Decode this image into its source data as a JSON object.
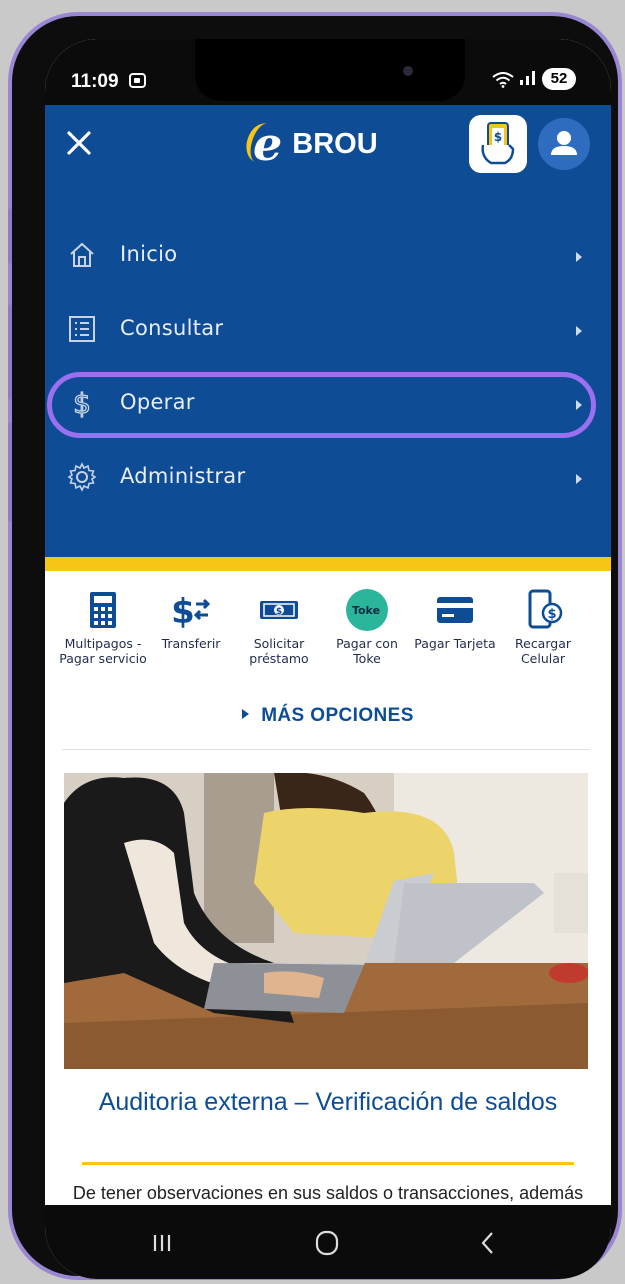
{
  "status_bar": {
    "time": "11:09",
    "battery": "52",
    "icons": [
      "screenshot-notification-icon",
      "wifi-icon",
      "signal-icon",
      "battery-icon"
    ]
  },
  "header": {
    "logo_text": "BROU",
    "brand_colors": {
      "blue": "#0e4c95",
      "yellow": "#f6c515",
      "highlight": "#9a6ff0"
    }
  },
  "menu": {
    "items": [
      {
        "label": "Inicio",
        "icon": "home-icon"
      },
      {
        "label": "Consultar",
        "icon": "list-icon"
      },
      {
        "label": "Operar",
        "icon": "dollar-icon",
        "highlighted": true
      },
      {
        "label": "Administrar",
        "icon": "gear-icon"
      }
    ]
  },
  "shortcuts": [
    {
      "label": "Multipagos - Pagar servicio",
      "icon": "calculator-icon"
    },
    {
      "label": "Transferir",
      "icon": "transfer-dollar-icon"
    },
    {
      "label": "Solicitar préstamo",
      "icon": "banknote-icon"
    },
    {
      "label": "Pagar con Toke",
      "icon": "toke-logo-icon",
      "icon_text": "Toke"
    },
    {
      "label": "Pagar Tarjeta",
      "icon": "credit-card-icon"
    },
    {
      "label": "Recargar Celular",
      "icon": "phone-recharge-icon"
    }
  ],
  "more_options": "MÁS OPCIONES",
  "article": {
    "title": "Auditoria externa – Verificación de saldos",
    "body": "De tener observaciones en sus saldos o transacciones, además de reclamar ante el Banco,"
  },
  "nav_bar": [
    "recent-apps-icon",
    "home-circle-icon",
    "back-icon"
  ]
}
